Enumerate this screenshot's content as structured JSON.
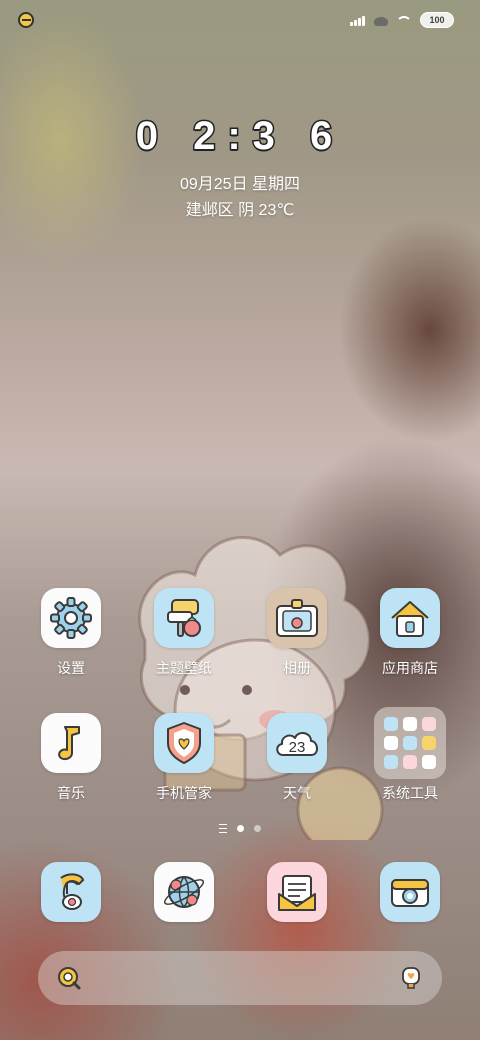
{
  "status_bar": {
    "battery": "100"
  },
  "clock": {
    "time": "0 2:3 6"
  },
  "date": "09月25日 星期四",
  "weather": "建邺区 阴 23℃",
  "apps_row1": [
    {
      "label": "设置",
      "icon": "gear-icon"
    },
    {
      "label": "主题壁纸",
      "icon": "paint-roller-icon"
    },
    {
      "label": "相册",
      "icon": "photo-frame-icon"
    },
    {
      "label": "应用商店",
      "icon": "house-icon"
    }
  ],
  "apps_row2": [
    {
      "label": "音乐",
      "icon": "music-note-icon"
    },
    {
      "label": "手机管家",
      "icon": "shield-heart-icon"
    },
    {
      "label": "天气",
      "icon": "cloud-icon",
      "icon_text": "23"
    },
    {
      "label": "系统工具",
      "icon": "folder-icon"
    }
  ],
  "dock": [
    {
      "icon": "phone-icon"
    },
    {
      "icon": "browser-globe-icon"
    },
    {
      "icon": "message-icon"
    },
    {
      "icon": "camera-icon"
    }
  ],
  "pages": {
    "count": 2,
    "active": 1
  },
  "colors": {
    "icon_blue": "#bde3f4",
    "icon_white": "#fbfbfb",
    "icon_pink": "#fbd6dc",
    "accent_orange": "#f0a64a",
    "accent_yellow": "#f6d36b"
  }
}
